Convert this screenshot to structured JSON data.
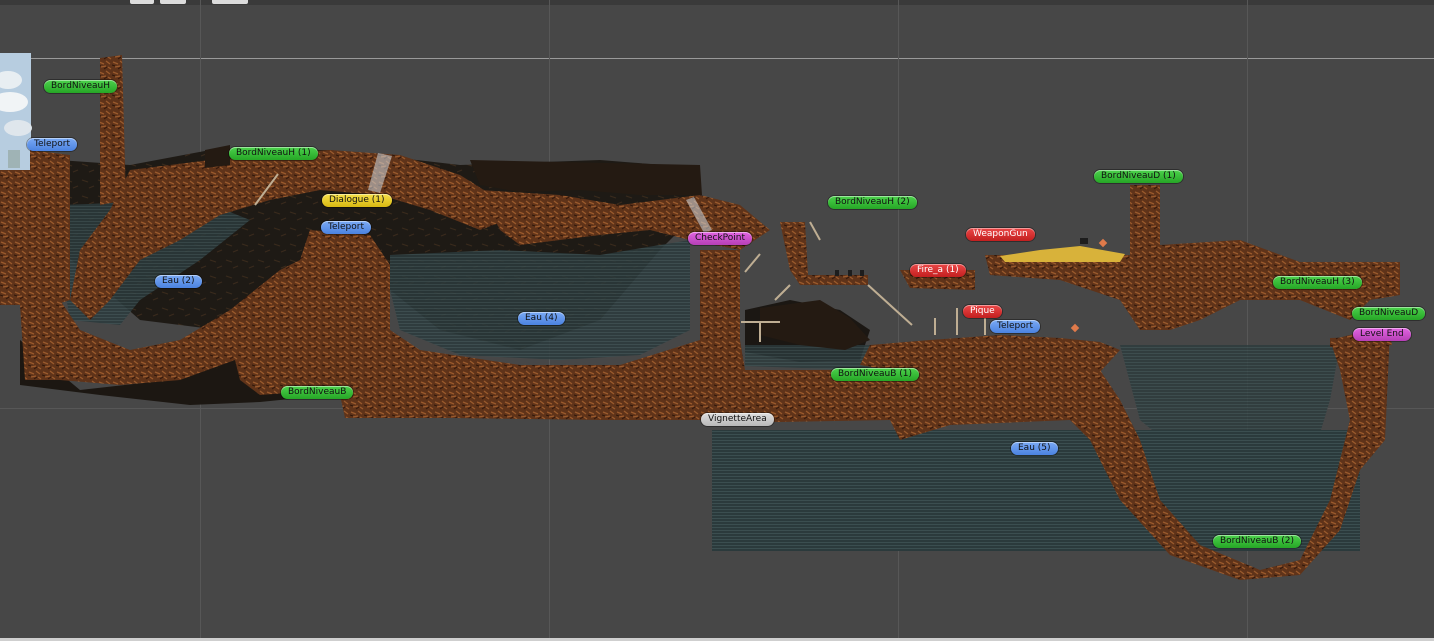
{
  "scene_view": {
    "background_color": "#474747",
    "grid_color": "#5a5a5a",
    "ground_color": "#6b3a1d",
    "water_color": "#2e3c3e"
  },
  "labels": {
    "bord_niveau_h": "BordNiveauH",
    "teleport_1": "Teleport",
    "bord_niveau_h_1": "BordNiveauH (1)",
    "dialogue_1": "Dialogue (1)",
    "teleport_2": "Teleport",
    "eau_2": "Eau (2)",
    "eau_4": "Eau (4)",
    "bord_niveau_b": "BordNiveauB",
    "checkpoint": "CheckPoint",
    "bord_niveau_h_2": "BordNiveauH (2)",
    "weapon_gun": "WeaponGun",
    "fire_a_1": "Fire_a (1)",
    "bord_niveau_d_1": "BordNiveauD (1)",
    "bord_niveau_h_3": "BordNiveauH (3)",
    "bord_niveau_d": "BordNiveauD",
    "level_end": "Level End",
    "pique": "Pique",
    "teleport_3": "Teleport",
    "bord_niveau_b_1": "BordNiveauB (1)",
    "vignette_area": "VignetteArea",
    "eau_5": "Eau (5)",
    "bord_niveau_b_2": "BordNiveauB (2)"
  }
}
